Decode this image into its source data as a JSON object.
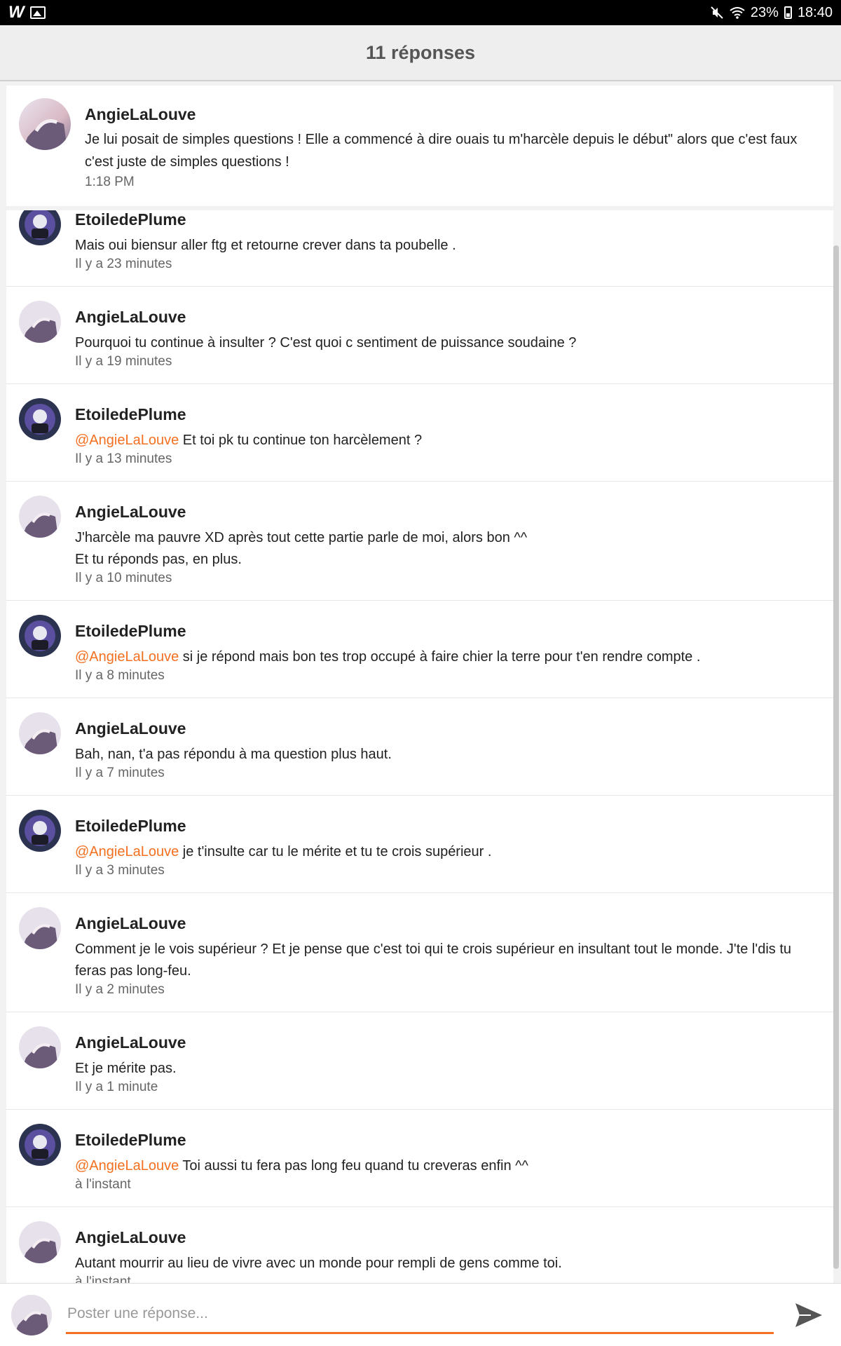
{
  "status_bar": {
    "logo": "W",
    "battery": "23%",
    "time": "18:40"
  },
  "header": {
    "title": "11 réponses"
  },
  "original_post": {
    "author": "AngieLaLouve",
    "text": "Je lui posait de simples questions ! Elle a commencé à dire  ouais tu m'harcèle depuis le début\" alors que c'est faux c'est juste de simples questions !",
    "time": "1:18 PM"
  },
  "replies": [
    {
      "author": "EtoiledePlume",
      "mention": "",
      "text": "Mais oui biensur aller ftg et retourne crever dans ta poubelle .",
      "time": "Il y a 23 minutes"
    },
    {
      "author": "AngieLaLouve",
      "mention": "",
      "text": "Pourquoi tu continue à insulter ? C'est quoi c sentiment de puissance soudaine ?",
      "time": "Il y a 19 minutes"
    },
    {
      "author": "EtoiledePlume",
      "mention": "@AngieLaLouve",
      "text": " Et toi pk tu continue ton harcèlement ?",
      "time": "Il y a 13 minutes"
    },
    {
      "author": "AngieLaLouve",
      "mention": "",
      "text": "J'harcèle ma pauvre XD après tout cette partie parle de moi, alors bon ^^\nEt tu réponds pas, en plus.",
      "time": "Il y a 10 minutes"
    },
    {
      "author": "EtoiledePlume",
      "mention": "@AngieLaLouve",
      "text": " si je répond mais bon tes trop occupé à faire chier la terre pour t'en rendre compte .",
      "time": "Il y a 8 minutes"
    },
    {
      "author": "AngieLaLouve",
      "mention": "",
      "text": "Bah, nan, t'a pas répondu à ma question plus haut.",
      "time": "Il y a 7 minutes"
    },
    {
      "author": "EtoiledePlume",
      "mention": "@AngieLaLouve",
      "text": " je t'insulte car tu le mérite et tu te crois supérieur .",
      "time": "Il y a 3 minutes"
    },
    {
      "author": "AngieLaLouve",
      "mention": "",
      "text": "Comment je le vois supérieur ? Et je pense que c'est toi qui te crois supérieur en insultant tout le monde. J'te l'dis tu feras pas long-feu.",
      "time": "Il y a 2 minutes"
    },
    {
      "author": "AngieLaLouve",
      "mention": "",
      "text": "Et je mérite pas.",
      "time": "Il y a 1 minute"
    },
    {
      "author": "EtoiledePlume",
      "mention": "@AngieLaLouve",
      "text": " Toi aussi tu fera pas long feu quand tu creveras enfin ^^",
      "time": "à l'instant"
    },
    {
      "author": "AngieLaLouve",
      "mention": "",
      "text": "Autant mourrir au lieu de vivre avec un monde pour rempli de gens comme toi.",
      "time": "à l'instant"
    }
  ],
  "composer": {
    "placeholder": "Poster une réponse..."
  },
  "colors": {
    "accent": "#f37021",
    "header_bg": "#eeeeee",
    "status_bar_bg": "#000000"
  }
}
